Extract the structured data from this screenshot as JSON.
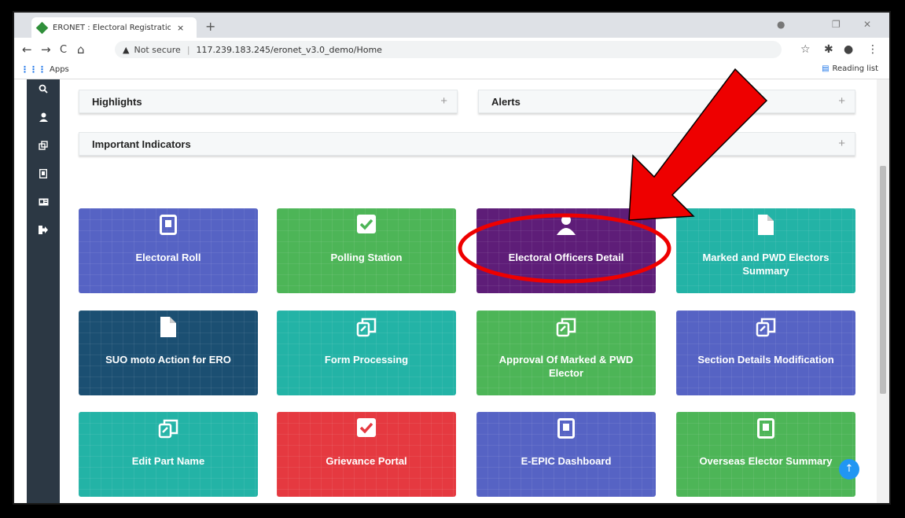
{
  "browser": {
    "tab_title": "ERONET : Electoral Registration C",
    "tab_close": "×",
    "new_tab": "+",
    "nav": {
      "back": "←",
      "forward": "→",
      "reload": "C",
      "home": "⌂"
    },
    "url": {
      "warning_icon": "▲",
      "security_label": "Not secure",
      "separator": "|",
      "address": "117.239.183.245/eronet_v3.0_demo/Home"
    },
    "bookmarks": {
      "apps_icon": "⋮⋮⋮",
      "apps_label": "Apps",
      "reading_list_icon": "▤",
      "reading_list_label": "Reading list"
    }
  },
  "panels": [
    {
      "title": "Highlights",
      "plus": "+"
    },
    {
      "title": "Alerts",
      "plus": "+"
    },
    {
      "title": "Important Indicators",
      "plus": "+"
    }
  ],
  "cards": [
    {
      "label": "Electoral Roll",
      "color": "#5663c4",
      "icon": "id-badge-icon"
    },
    {
      "label": "Polling Station",
      "color": "#4db557",
      "icon": "checkbox-icon"
    },
    {
      "label": "Electoral Officers Detail",
      "color": "#5e1d78",
      "icon": "user-icon"
    },
    {
      "label": "Marked and PWD Electors Summary",
      "color": "#23b3a6",
      "icon": "file-icon"
    },
    {
      "label": "SUO moto Action for ERO",
      "color": "#1b4f72",
      "icon": "file-icon"
    },
    {
      "label": "Form Processing",
      "color": "#23b3a6",
      "icon": "clone-icon"
    },
    {
      "label": "Approval Of Marked & PWD Elector",
      "color": "#4db557",
      "icon": "clone-icon"
    },
    {
      "label": "Section Details Modification",
      "color": "#5663c4",
      "icon": "clone-icon"
    },
    {
      "label": "Edit Part Name",
      "color": "#23b3a6",
      "icon": "clone-icon"
    },
    {
      "label": "Grievance Portal",
      "color": "#e53940",
      "icon": "checkbox-icon"
    },
    {
      "label": "E-EPIC Dashboard",
      "color": "#5663c4",
      "icon": "id-badge-icon"
    },
    {
      "label": "Overseas Elector Summary",
      "color": "#4db557",
      "icon": "id-badge-icon"
    }
  ],
  "scroll_top_icon": "↑",
  "annotation": {
    "arrow_color": "#ee0000",
    "ellipse_color": "#ee0000"
  }
}
